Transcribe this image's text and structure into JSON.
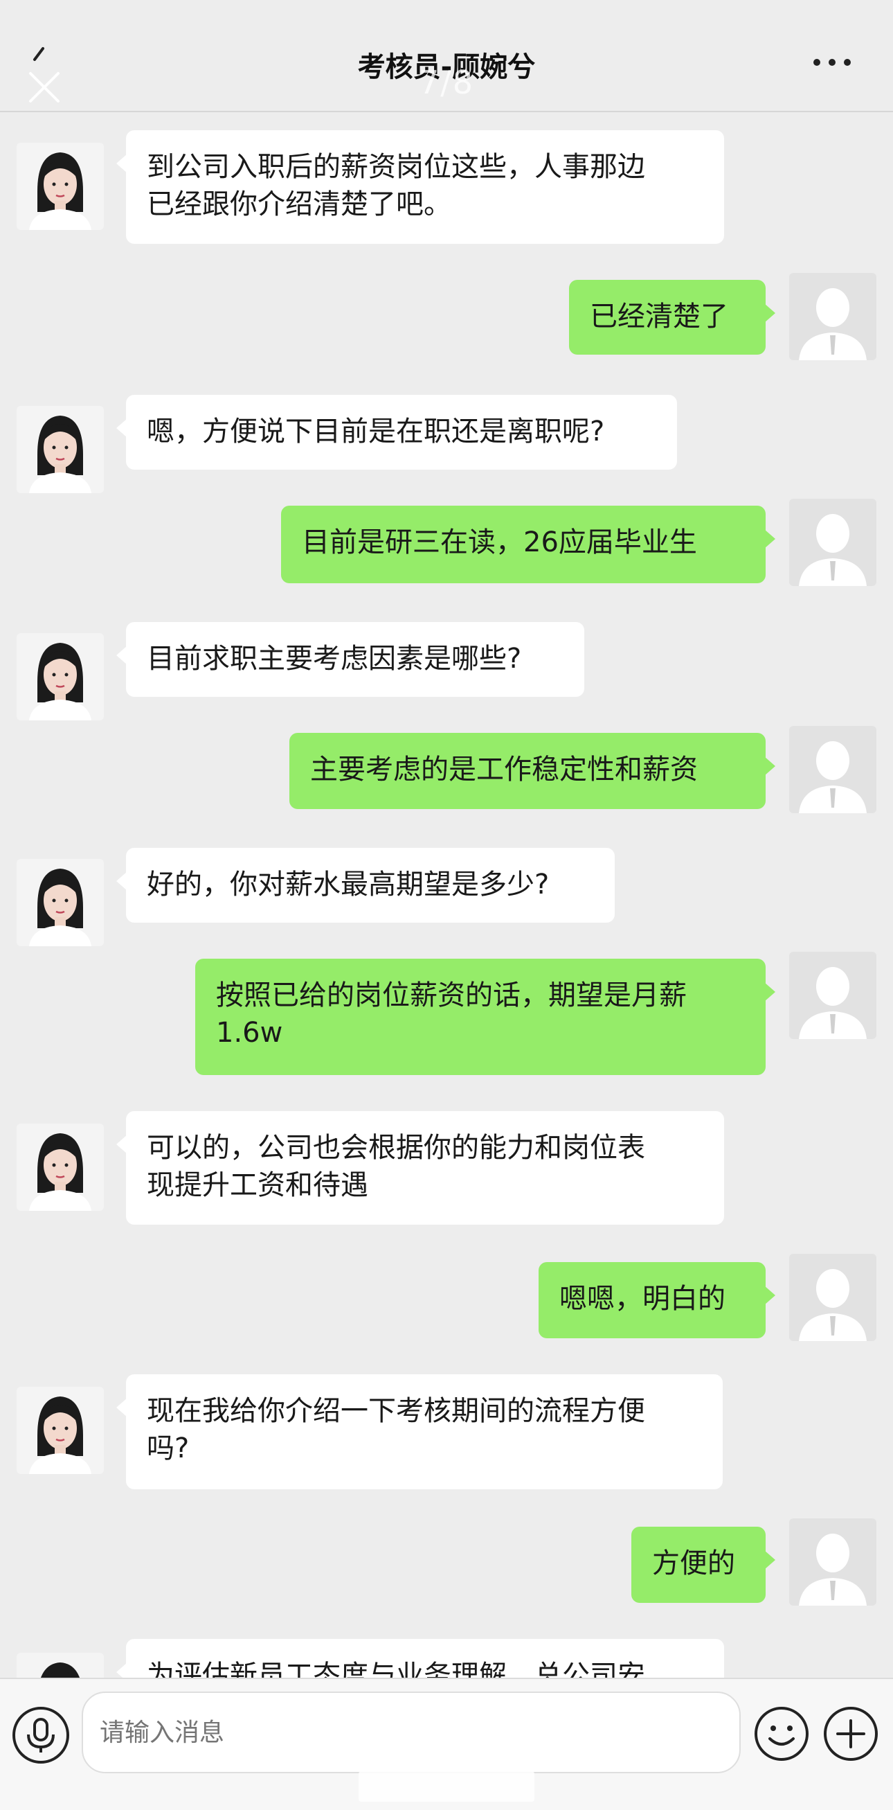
{
  "header": {
    "title": "考核员-顾婉兮",
    "page_indicator": "7/8"
  },
  "messages": [
    {
      "side": "left",
      "text": "到公司入职后的薪资岗位这些，人事那边\n已经跟你介绍清楚了吧。"
    },
    {
      "side": "right",
      "text": "已经清楚了"
    },
    {
      "side": "left",
      "text": "嗯，方便说下目前是在职还是离职呢?"
    },
    {
      "side": "right",
      "text": "目前是研三在读，26应届毕业生"
    },
    {
      "side": "left",
      "text": "目前求职主要考虑因素是哪些?"
    },
    {
      "side": "right",
      "text": "主要考虑的是工作稳定性和薪资"
    },
    {
      "side": "left",
      "text": "好的，你对薪水最高期望是多少?"
    },
    {
      "side": "right",
      "text": "按照已给的岗位薪资的话，期望是月薪\n1.6w"
    },
    {
      "side": "left",
      "text": "可以的，公司也会根据你的能力和岗位表\n现提升工资和待遇"
    },
    {
      "side": "right",
      "text": "嗯嗯，明白的"
    },
    {
      "side": "left",
      "text": "现在我给你介绍一下考核期间的流程方便\n吗?"
    },
    {
      "side": "right",
      "text": "方便的"
    },
    {
      "side": "left",
      "text": "为评估新员工态度与业务理解，总公司安"
    }
  ],
  "input": {
    "placeholder": "请输入消息"
  },
  "colors": {
    "background": "#ededed",
    "right_bubble": "#95ec69",
    "left_bubble": "#ffffff"
  },
  "icons": [
    "back-icon",
    "close-icon",
    "more-icon",
    "microphone-icon",
    "emoji-icon",
    "plus-icon"
  ]
}
